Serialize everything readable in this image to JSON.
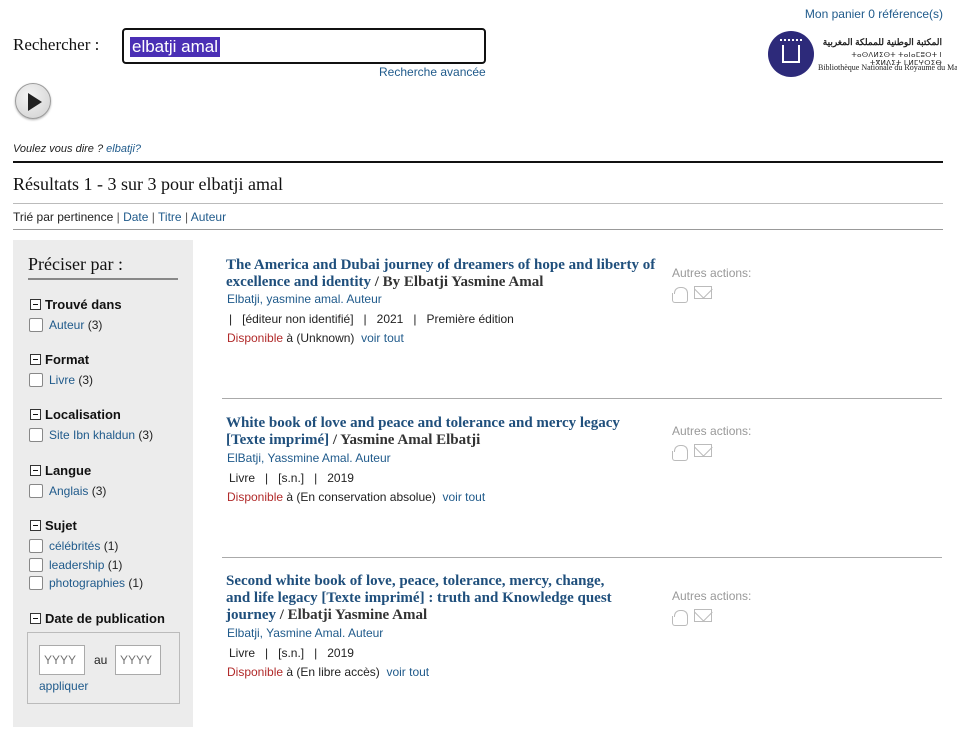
{
  "header": {
    "cart_label": "Mon panier 0 référence(s)",
    "search_label": "Rechercher :",
    "search_value": "elbatji amal",
    "advanced_search": "Recherche avancée",
    "logo_arabic": "المكتبة الوطنية للمملكة المغربية",
    "logo_tifinagh": "ⵜⴰⵙⴷⵍⵉⵙⵜ ⵜⴰⵏⴰⵎⵓⵔⵜ ⵏ ⵜⴳⵍⴷⵉⵜ ⵏ ⵍⵎⵖⵔⵉⴱ",
    "logo_french": "Bibliothèque Nationale du Royaume du Maroc"
  },
  "suggestion": {
    "prefix": "Voulez vous dire ?",
    "term": "elbatji?"
  },
  "results_summary": "Résultats 1 - 3 sur 3 pour elbatji amal",
  "sort": {
    "prefix": "Trié par  pertinence",
    "sep": "|",
    "options": [
      "Date",
      "Titre",
      "Auteur"
    ]
  },
  "facets": {
    "title": "Préciser par :",
    "groups": [
      {
        "label": "Trouvé dans",
        "items": [
          {
            "label": "Auteur",
            "count": "(3)"
          }
        ]
      },
      {
        "label": "Format",
        "items": [
          {
            "label": "Livre",
            "count": "(3)"
          }
        ]
      },
      {
        "label": "Localisation",
        "items": [
          {
            "label": "Site Ibn khaldun",
            "count": "(3)"
          }
        ]
      },
      {
        "label": "Langue",
        "items": [
          {
            "label": "Anglais",
            "count": "(3)"
          }
        ]
      },
      {
        "label": "Sujet",
        "items": [
          {
            "label": "célébrités",
            "count": "(1)"
          },
          {
            "label": "leadership",
            "count": "(1)"
          },
          {
            "label": "photographies",
            "count": "(1)"
          }
        ]
      },
      {
        "label": "Date de publication",
        "items": []
      }
    ],
    "date_from_placeholder": "YYYY",
    "date_to_placeholder": "YYYY",
    "date_sep": "au",
    "apply": "appliquer"
  },
  "results": [
    {
      "title": "The America and Dubai journey of dreamers of hope and liberty of excellence and identity",
      "by": "/ By Elbatji Yasmine Amal",
      "author": "Elbatji, yasmine amal. Auteur",
      "meta": "|   [éditeur non identifié]   |   2021   |   Première édition",
      "available": "Disponible",
      "location": "à (Unknown)",
      "see_all": "voir tout",
      "other_actions": "Autres actions:"
    },
    {
      "title": "White book of love and peace and tolerance and mercy legacy [Texte imprimé]",
      "by": "/ Yasmine Amal Elbatji",
      "author": "ElBatji, Yassmine Amal. Auteur",
      "meta": "Livre   |   [s.n.]   |   2019",
      "available": "Disponible",
      "location": "à (En conservation absolue)",
      "see_all": "voir tout",
      "other_actions": "Autres actions:"
    },
    {
      "title": "Second white book of love, peace, tolerance, mercy, change, and life legacy [Texte imprimé] : truth and Knowledge quest journey",
      "by": "/ Elbatji Yasmine Amal",
      "author": "Elbatji, Yasmine Amal. Auteur",
      "meta": "Livre   |   [s.n.]   |   2019",
      "available": "Disponible",
      "location": "à (En libre accès)",
      "see_all": "voir tout",
      "other_actions": "Autres actions:"
    }
  ]
}
